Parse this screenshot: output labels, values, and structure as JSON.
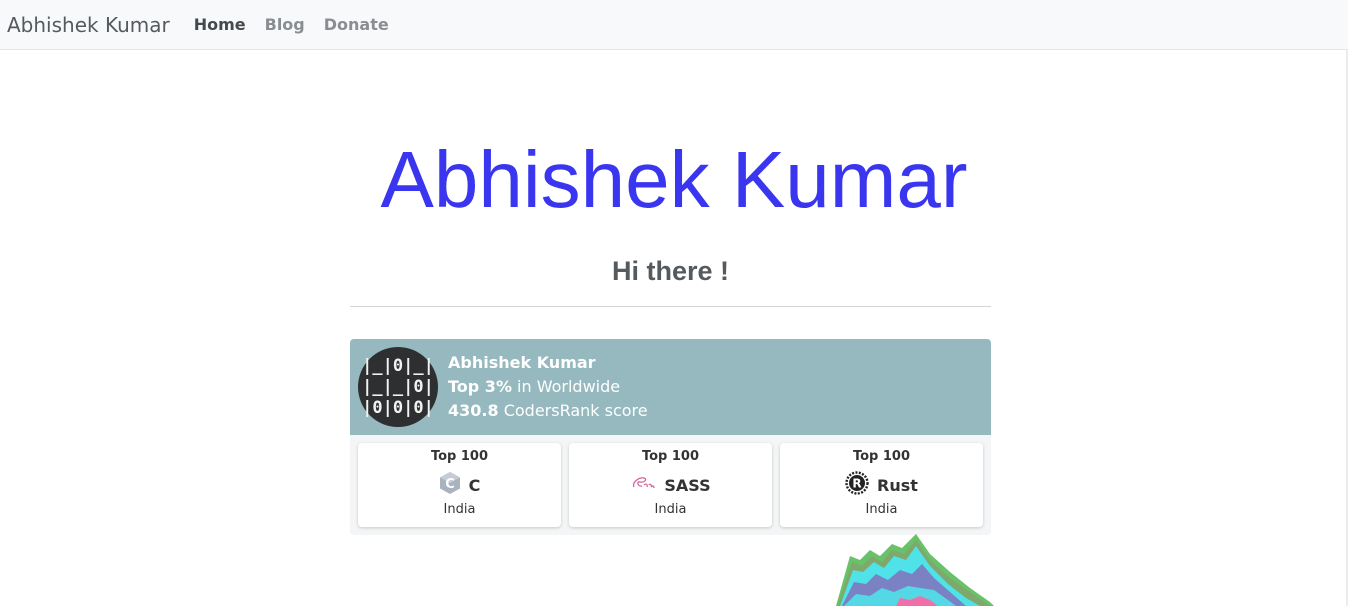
{
  "navbar": {
    "brand": "Abhishek Kumar",
    "links": [
      {
        "label": "Home",
        "active": true
      },
      {
        "label": "Blog",
        "active": false
      },
      {
        "label": "Donate",
        "active": false
      }
    ]
  },
  "hero": {
    "title": "Abhishek Kumar",
    "subtitle": "Hi there !"
  },
  "codersrank": {
    "name": "Abhishek Kumar",
    "rank_strong": "Top 3%",
    "rank_rest": " in Worldwide",
    "score_strong": "430.8",
    "score_rest": " CodersRank score",
    "avatar_lines": [
      "|_|0|_|",
      "|_|_|0|",
      "|0|0|0|"
    ],
    "cards": [
      {
        "rank": "Top 100",
        "language": "C",
        "icon": "c-language-icon",
        "country": "India"
      },
      {
        "rank": "Top 100",
        "language": "SASS",
        "icon": "sass-icon",
        "country": "India"
      },
      {
        "rank": "Top 100",
        "language": "Rust",
        "icon": "rust-icon",
        "country": "India"
      }
    ]
  },
  "colors": {
    "title": "#3a36f0",
    "widget_header": "#95b9bf",
    "stream_green": "#69c26a",
    "stream_cyan": "#4fe2e8",
    "stream_purple": "#7b82c4",
    "stream_pink": "#ef6fa8"
  }
}
